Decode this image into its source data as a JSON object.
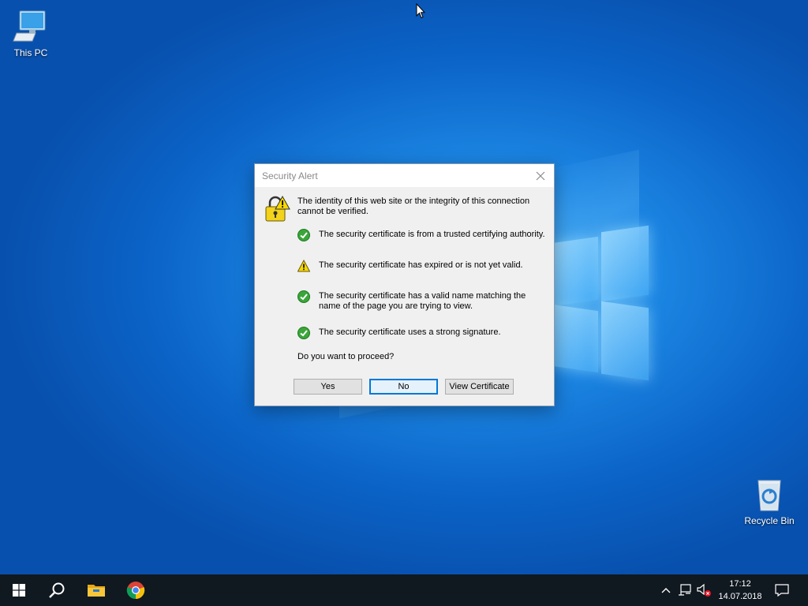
{
  "desktop": {
    "icons": [
      {
        "label": "This PC",
        "icon": "computer-icon"
      },
      {
        "label": "Recycle Bin",
        "icon": "recycle-bin-icon"
      }
    ]
  },
  "dialog": {
    "title": "Security Alert",
    "intro": "The identity of this web site or the integrity of this connection cannot be verified.",
    "checks": [
      {
        "status": "ok",
        "icon": "check-icon",
        "text": "The security certificate is from a trusted certifying authority."
      },
      {
        "status": "warning",
        "icon": "warning-icon",
        "text": "The security certificate has expired or is not yet valid."
      },
      {
        "status": "ok",
        "icon": "check-icon",
        "text": "The security certificate has a valid name matching the name of the page you are trying to view."
      },
      {
        "status": "ok",
        "icon": "check-icon",
        "text": "The security certificate uses a strong signature."
      }
    ],
    "question": "Do you want to proceed?",
    "buttons": {
      "yes": "Yes",
      "no": "No",
      "view_certificate": "View Certificate"
    },
    "default_button": "no"
  },
  "taskbar": {
    "items": [
      "start-icon",
      "search-icon",
      "file-explorer-icon",
      "chrome-icon"
    ],
    "tray": [
      "chevron-up-icon",
      "network-icon",
      "volume-muted-icon",
      "notifications-icon"
    ],
    "clock": {
      "time": "17:12",
      "date": "14.07.2018"
    }
  },
  "colors": {
    "accent": "#0078d7",
    "taskbar": "#101820",
    "desktop": "#0b63c7"
  }
}
